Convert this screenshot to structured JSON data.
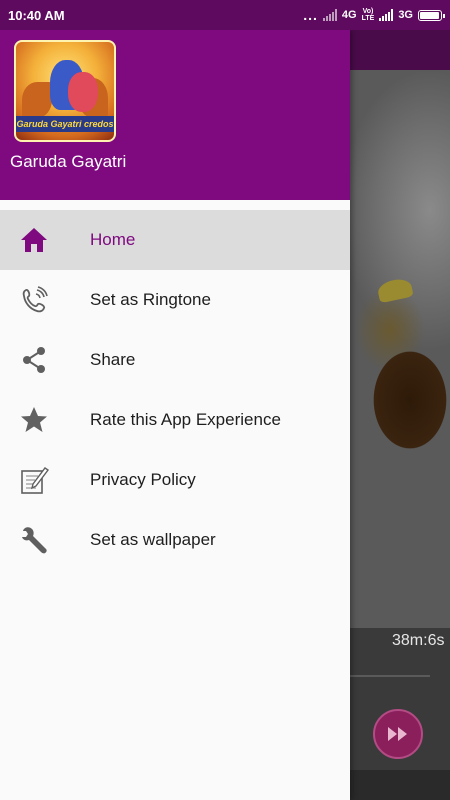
{
  "status_bar": {
    "time": "10:40 AM",
    "dots": "...",
    "network1": "4G",
    "volte_top": "Vo)",
    "volte_bottom": "LTE",
    "network2": "3G"
  },
  "drawer": {
    "logo_text": "Garuda Gayatri credos",
    "title": "Garuda Gayatri",
    "items": [
      {
        "label": "Home",
        "icon": "home-icon",
        "active": true
      },
      {
        "label": "Set as Ringtone",
        "icon": "phone-ringing-icon"
      },
      {
        "label": "Share",
        "icon": "share-icon"
      },
      {
        "label": "Rate this App Experience",
        "icon": "star-icon"
      },
      {
        "label": "Privacy Policy",
        "icon": "edit-document-icon"
      },
      {
        "label": "Set as wallpaper",
        "icon": "wrench-icon"
      }
    ]
  },
  "player": {
    "time": "38m:6s",
    "ff_icon": "fast-forward-icon"
  },
  "colors": {
    "accent": "#7f0a80",
    "status_bar": "#5e0a5e",
    "active_item_bg": "#dcdcdc",
    "icon_gray": "#5f5f5f"
  }
}
